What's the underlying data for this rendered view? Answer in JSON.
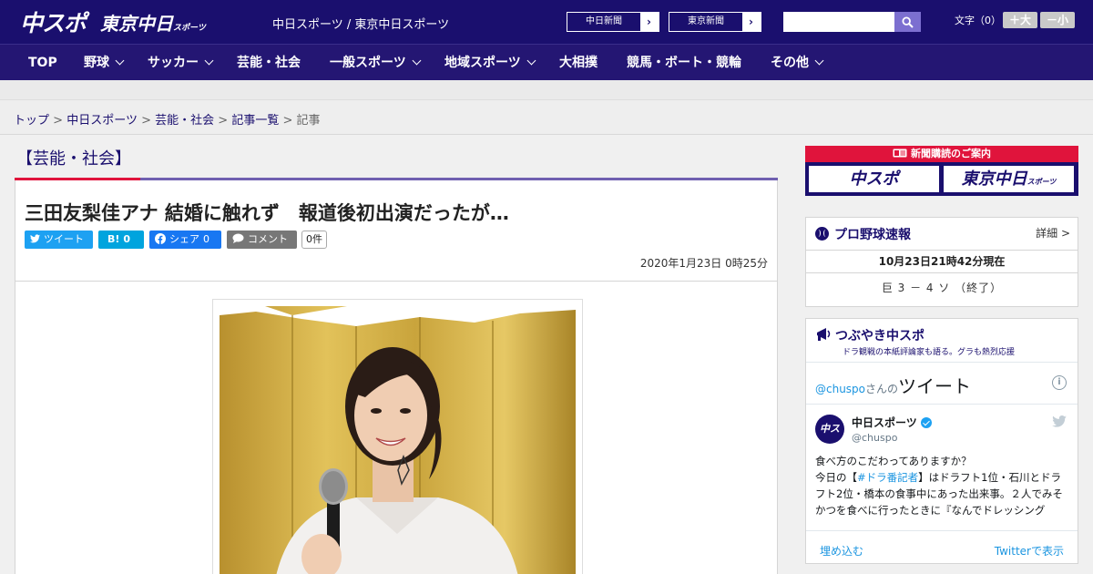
{
  "header": {
    "logo": "中スポ",
    "logo_sub": "東京中日",
    "logo_sub_small": "スポーツ",
    "site_links": "中日スポーツ / 東京中日スポーツ",
    "paper_buttons": [
      {
        "label": "中日新聞",
        "arrow": "›"
      },
      {
        "label": "東京新聞",
        "arrow": "›"
      }
    ],
    "search_placeholder": "",
    "font_size_label": "文字（0）",
    "font_plus": "＋大",
    "font_minus": "－小"
  },
  "nav": [
    {
      "label": "TOP",
      "dropdown": false
    },
    {
      "label": "野球",
      "dropdown": true
    },
    {
      "label": "サッカー",
      "dropdown": true
    },
    {
      "label": "芸能・社会",
      "dropdown": false
    },
    {
      "label": "一般スポーツ",
      "dropdown": true
    },
    {
      "label": "地域スポーツ",
      "dropdown": true
    },
    {
      "label": "大相撲",
      "dropdown": false
    },
    {
      "label": "競馬・ボート・競輪",
      "dropdown": false
    },
    {
      "label": "その他",
      "dropdown": true
    }
  ],
  "breadcrumb": {
    "links": [
      "トップ",
      "中日スポーツ",
      "芸能・社会",
      "記事一覧"
    ],
    "separator": ">",
    "current": "記事"
  },
  "article": {
    "section": "【芸能・社会】",
    "headline": "三田友梨佳アナ 結婚に触れず　報道後初出演だったが…",
    "share": {
      "tweet": "ツイート",
      "hatena": "B!",
      "hatena_count": "0",
      "facebook": "シェア",
      "facebook_count": "0",
      "comment": "コメント",
      "comment_count": "0件"
    },
    "date": "2020年1月23日 0時25分"
  },
  "sidebar": {
    "subscription": {
      "header": "新聞購読のご案内",
      "logo_left": "中スポ",
      "logo_right": "東京中日",
      "logo_right_small": "スポーツ"
    },
    "baseball": {
      "title": "プロ野球速報",
      "detail": "詳細 >",
      "time": "10月23日21時42分現在",
      "score": "巨 3 － 4 ソ （終了）"
    },
    "tweets": {
      "title": "つぶやき中スポ",
      "subtitle": "ドラ観戦の本紙評論家も語る。グラも熱烈応援",
      "widget_handle": "@chuspo",
      "widget_san": "さんの",
      "widget_title": "ツイート",
      "info": "i",
      "author_name": "中日スポーツ",
      "author_handle": "@chuspo",
      "avatar_text": "中スポ",
      "text_1": "食べ方のこだわってありますか？",
      "text_2a": "今日の【",
      "text_2b": "#ドラ番記者",
      "text_2c": "】はドラフト1位・石川とドラフト2位・橋本の食事中にあった出来事。２人でみそかつを食べに行ったときに『なんでドレッシング",
      "embed": "埋め込む",
      "view_on_twitter": "Twitterで表示"
    }
  },
  "colors": {
    "brand": "#1a0f6e",
    "nav": "#241673",
    "accent_red": "#e0143c",
    "twitter": "#1da1f2",
    "facebook": "#1877f2",
    "hatena": "#00a4de"
  }
}
